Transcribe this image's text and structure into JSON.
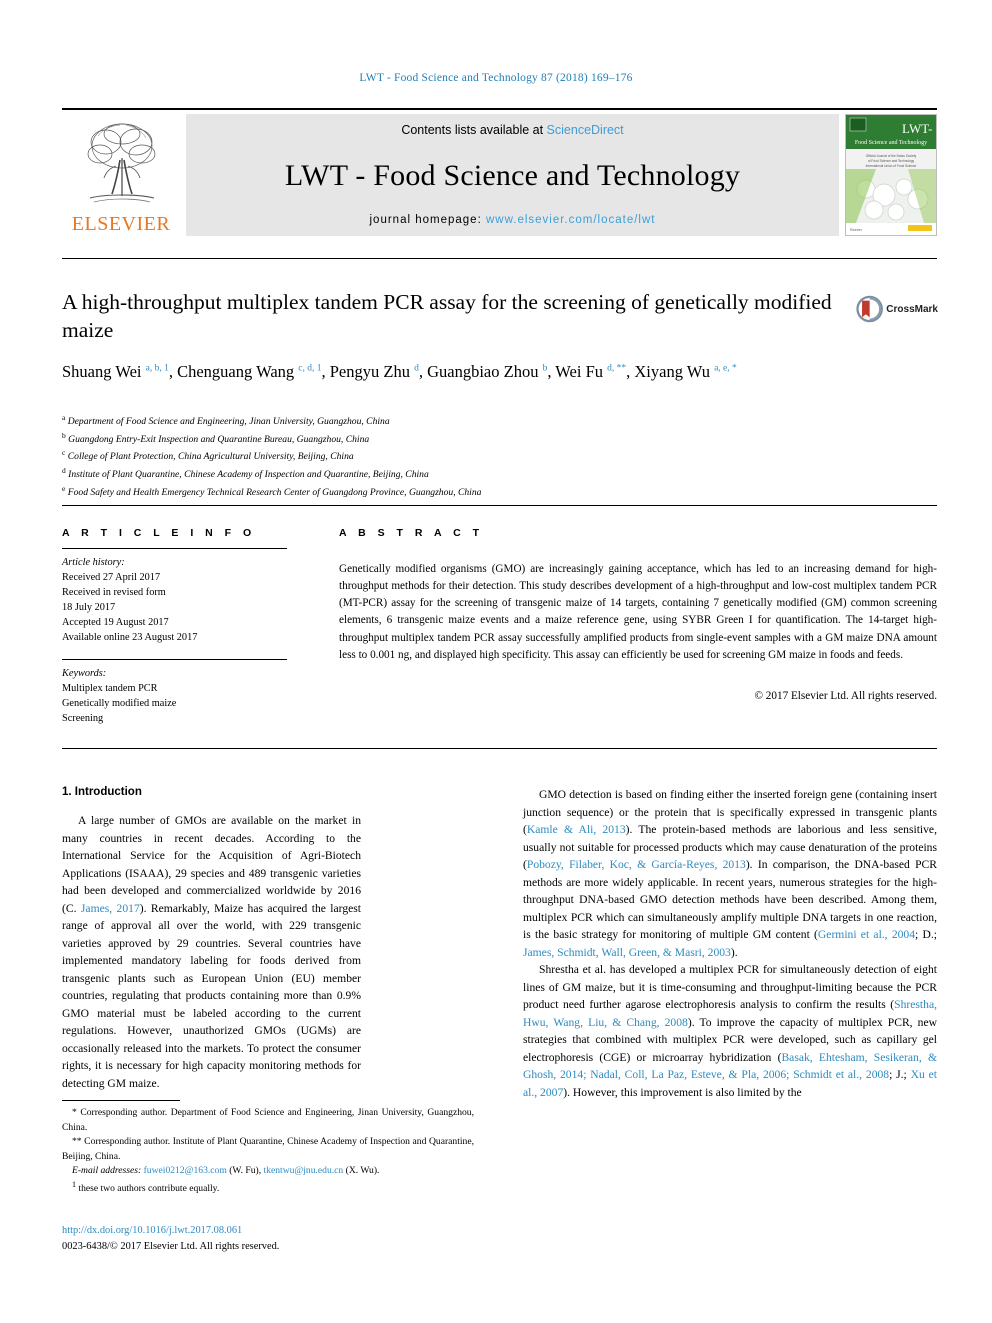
{
  "running_head": "LWT - Food Science and Technology 87 (2018) 169–176",
  "masthead": {
    "publisher": "ELSEVIER",
    "contents_prefix": "Contents lists available at ",
    "contents_link": "ScienceDirect",
    "journal_name": "LWT - Food Science and Technology",
    "homepage_prefix": "journal homepage: ",
    "homepage_url": "www.elsevier.com/locate/lwt",
    "cover_title": "LWT-",
    "cover_subtitle": "Food Science and Technology"
  },
  "article": {
    "title": "A high-throughput multiplex tandem PCR assay for the screening of genetically modified maize",
    "crossmark_label": "CrossMark",
    "authors_html": "Shuang Wei <sup>a, b, 1</sup>, Chenguang Wang <sup>c, d, 1</sup>, Pengyu Zhu <sup>d</sup>, Guangbiao Zhou <sup>b</sup>, Wei Fu <sup>d, **</sup>, Xiyang Wu <sup>a, e, *</sup>",
    "affiliations": [
      {
        "marker": "a",
        "text": "Department of Food Science and Engineering, Jinan University, Guangzhou, China"
      },
      {
        "marker": "b",
        "text": "Guangdong Entry-Exit Inspection and Quarantine Bureau, Guangzhou, China"
      },
      {
        "marker": "c",
        "text": "College of Plant Protection, China Agricultural University, Beijing, China"
      },
      {
        "marker": "d",
        "text": "Institute of Plant Quarantine, Chinese Academy of Inspection and Quarantine, Beijing, China"
      },
      {
        "marker": "e",
        "text": "Food Safety and Health Emergency Technical Research Center of Guangdong Province, Guangzhou, China"
      }
    ]
  },
  "article_info": {
    "heading": "A R T I C L E   I N F O",
    "history_label": "Article history:",
    "history": [
      "Received 27 April 2017",
      "Received in revised form",
      "18 July 2017",
      "Accepted 19 August 2017",
      "Available online 23 August 2017"
    ],
    "keywords_label": "Keywords:",
    "keywords": [
      "Multiplex tandem PCR",
      "Genetically modified maize",
      "Screening"
    ]
  },
  "abstract": {
    "heading": "A B S T R A C T",
    "text": "Genetically modified organisms (GMO) are increasingly gaining acceptance, which has led to an increasing demand for high-throughput methods for their detection. This study describes development of a high-throughput and low-cost multiplex tandem PCR (MT-PCR) assay for the screening of transgenic maize of 14 targets, containing 7 genetically modified (GM) common screening elements, 6 transgenic maize events and a maize reference gene, using SYBR Green I for quantification. The 14-target high-throughput multiplex tandem PCR assay successfully amplified products from single-event samples with a GM maize DNA amount less to 0.001 ng, and displayed high specificity. This assay can efficiently be used for screening GM maize in foods and feeds.",
    "copyright": "© 2017 Elsevier Ltd. All rights reserved."
  },
  "introduction": {
    "heading": "1.  Introduction",
    "left_paragraph_1": "A large number of GMOs are available on the market in many countries in recent decades. According to the International Service for the Acquisition of Agri-Biotech Applications (ISAAA), 29 species and 489 transgenic varieties had been developed and commercialized worldwide by 2016 (C. ",
    "left_cite_1": "James, 2017",
    "left_paragraph_1b": "). Remarkably, Maize has acquired the largest range of approval all over the world, with 229 transgenic varieties approved by 29 countries. Several countries have implemented mandatory labeling for foods derived from transgenic plants such as European Union (EU) member countries, regulating that products containing more than 0.9% GMO material must be labeled according to the current regulations. However, unauthorized GMOs (UGMs) are occasionally released into the markets. To protect the consumer rights, it is necessary for high capacity monitoring methods for detecting GM maize.",
    "right_p1_a": "GMO detection is based on finding either the inserted foreign gene (containing insert junction sequence) or the protein that is specifically expressed in transgenic plants (",
    "right_p1_cite1": "Kamle & Ali, 2013",
    "right_p1_b": "). The protein-based methods are laborious and less sensitive, usually not suitable for processed products which may cause denaturation of the proteins (",
    "right_p1_cite2": "Pobozy, Filaber, Koc, & García-Reyes, 2013",
    "right_p1_c": "). In comparison, the DNA-based PCR methods are more widely applicable. In recent years, numerous strategies for the high-throughput DNA-based GMO detection methods have been described. Among them, multiplex PCR which can simultaneously amplify multiple DNA targets in one reaction, is the basic strategy for monitoring of multiple GM content (",
    "right_p1_cite3": "Germini et al., 2004",
    "right_p1_d": "; D.; ",
    "right_p1_cite4": "James, Schmidt, Wall, Green, & Masri, 2003",
    "right_p1_e": ").",
    "right_p2_a": "Shrestha et al. has developed a multiplex PCR for simultaneously detection of eight lines of GM maize, but it is time-consuming and throughput-limiting because the PCR product need further agarose electrophoresis analysis to confirm the results (",
    "right_p2_cite1": "Shrestha, Hwu, Wang, Liu, & Chang, 2008",
    "right_p2_b": "). To improve the capacity of multiplex PCR, new strategies that combined with multiplex PCR were developed, such as capillary gel electrophoresis (CGE) or microarray hybridization (",
    "right_p2_cite2": "Basak, Ehtesham, Sesikeran, & Ghosh, 2014; Nadal, Coll, La Paz, Esteve, & Pla, 2006; Schmidt et al., 2008",
    "right_p2_c": "; J.; ",
    "right_p2_cite3": "Xu et al., 2007",
    "right_p2_d": "). However, this improvement is also limited by the"
  },
  "footnotes": {
    "corr1": "Corresponding author. Department of Food Science and Engineering, Jinan University, Guangzhou, China.",
    "corr1_marker": "*",
    "corr2": "Corresponding author. Institute of Plant Quarantine, Chinese Academy of Inspection and Quarantine, Beijing, China.",
    "corr2_marker": "**",
    "email_label": "E-mail addresses:",
    "email1": "fuwei0212@163.com",
    "email1_name": "(W. Fu),",
    "email2": "tkentwu@jnu.edu.cn",
    "email2_name": "(X. Wu).",
    "equal_marker": "1",
    "equal_text": "these two authors contribute equally.",
    "doi": "http://dx.doi.org/10.1016/j.lwt.2017.08.061",
    "issn": "0023-6438/© 2017 Elsevier Ltd. All rights reserved."
  },
  "colors": {
    "link_blue": "#2e8bc0",
    "elsevier_orange": "#E87722",
    "band_gray": "#e6e6e6"
  }
}
